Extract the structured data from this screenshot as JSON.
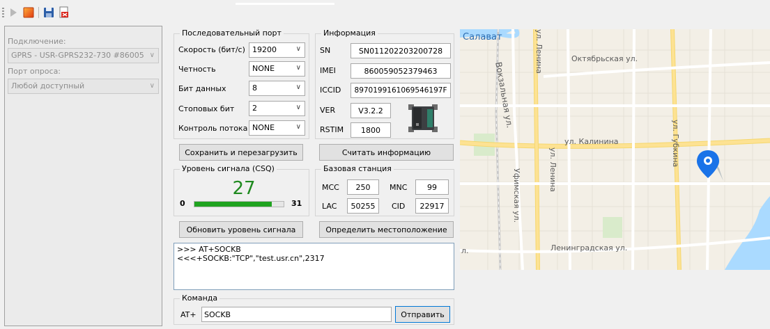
{
  "toolbar": {
    "icons": [
      "play-icon",
      "stop-icon",
      "save-icon",
      "export-icon"
    ]
  },
  "left_panel": {
    "connection_label": "Подключение:",
    "connection_value": "GPRS - USR-GPRS232-730 #86005",
    "port_label": "Порт опроса:",
    "port_value": "Любой доступный"
  },
  "serial": {
    "title": "Последовательный порт",
    "speed_label": "Скорость (бит/с)",
    "speed_value": "19200",
    "parity_label": "Четность",
    "parity_value": "NONE",
    "data_bits_label": "Бит данных",
    "data_bits_value": "8",
    "stop_bits_label": "Стоповых бит",
    "stop_bits_value": "2",
    "flow_label": "Контроль потока",
    "flow_value": "NONE",
    "save_button": "Сохранить и перезагрузить"
  },
  "info": {
    "title": "Информация",
    "sn_label": "SN",
    "sn_value": "SN011202203200728",
    "imei_label": "IMEI",
    "imei_value": "860059052379463",
    "iccid_label": "ICCID",
    "iccid_value": "8970199161069546197F",
    "ver_label": "VER",
    "ver_value": "V3.2.2",
    "rstim_label": "RSTIM",
    "rstim_value": "1800",
    "read_button": "Считать информацию"
  },
  "signal": {
    "title": "Уровень сигнала (CSQ)",
    "value": "27",
    "min": "0",
    "max": "31",
    "level": 27,
    "level_max": 31,
    "update_button": "Обновить уровень сигнала"
  },
  "base_station": {
    "title": "Базовая станция",
    "mcc_label": "MCC",
    "mcc_value": "250",
    "mnc_label": "MNC",
    "mnc_value": "99",
    "lac_label": "LAC",
    "lac_value": "50255",
    "cid_label": "CID",
    "cid_value": "22917",
    "locate_button": "Определить местоположение"
  },
  "log": {
    "lines": [
      ">>> AT+SOCKB",
      "<<<+SOCKB:\"TCP\",\"test.usr.cn\",2317"
    ]
  },
  "command": {
    "title": "Команда",
    "prefix": "AT+",
    "value": "SOCKB",
    "send_button": "Отправить"
  },
  "map": {
    "labels": {
      "salavat": "Салават",
      "lenina_top": "ул. Ленина",
      "oktyabrskaya": "Октябрьская ул.",
      "vokzalnaya": "Вокзальная ул.",
      "kalinina": "ул. Калинина",
      "gubkina": "ул. Губкина",
      "lenina_mid": "ул. Ленина",
      "ufimskaya": "Уфимская ул.",
      "leningradskaya": "Ленинградская ул.",
      "ul_left": "л."
    },
    "colors": {
      "water": "#aadaff",
      "road": "#ffffff",
      "road_major": "#fde293",
      "pin": "#1a73e8"
    }
  }
}
